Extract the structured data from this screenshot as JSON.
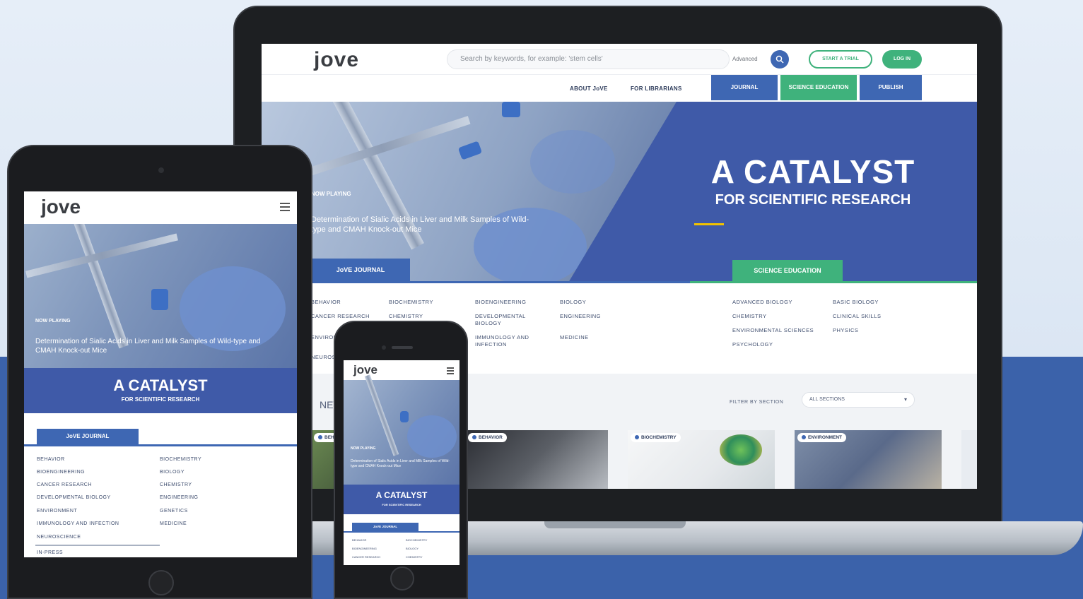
{
  "colors": {
    "brand_blue": "#3e67b3",
    "hero_blue": "#3f5aa8",
    "brand_green": "#3fb27c",
    "accent_yellow": "#f2c300",
    "background_blue": "#3b62aa"
  },
  "laptop": {
    "logo": "jove",
    "search_placeholder": "Search by keywords, for example: 'stem cells'",
    "advanced": "Advanced",
    "search_icon": "search-icon",
    "start_trial": "START A TRIAL",
    "login": "LOG IN",
    "nav": {
      "about": "ABOUT JoVE",
      "librarians": "FOR LIBRARIANS",
      "journal": "JOURNAL",
      "science_education": "SCIENCE EDUCATION",
      "publish": "PUBLISH"
    },
    "hero": {
      "title": "A CATALYST",
      "subtitle": "FOR SCIENTIFIC RESEARCH",
      "now_playing": "NOW PLAYING",
      "video_title": "Determination of Sialic Acids in Liver and Milk Samples of Wild-type and CMAH Knock-out Mice",
      "tab_journal": "JoVE JOURNAL",
      "tab_science": "SCIENCE EDUCATION"
    },
    "journal_categories": [
      "BEHAVIOR",
      "BIOCHEMISTRY",
      "BIOENGINEERING",
      "BIOLOGY",
      "CANCER RESEARCH",
      "CHEMISTRY",
      "DEVELOPMENTAL BIOLOGY",
      "ENGINEERING",
      "ENVIRONMENT",
      "IMMUNOLOGY AND INFECTION",
      "MEDICINE",
      "NEUROSCIENCE"
    ],
    "science_categories": [
      "ADVANCED BIOLOGY",
      "BASIC BIOLOGY",
      "CHEMISTRY",
      "CLINICAL SKILLS",
      "ENVIRONMENTAL SCIENCES",
      "PHYSICS",
      "PSYCHOLOGY"
    ],
    "new_heading": "NEW",
    "filter_label": "FILTER BY SECTION",
    "filter_value": "ALL SECTIONS",
    "cards": [
      {
        "tag": "BEHAVIOR"
      },
      {
        "tag": "BEHAVIOR"
      },
      {
        "tag": "BIOCHEMISTRY"
      },
      {
        "tag": "ENVIRONMENT"
      }
    ]
  },
  "tablet": {
    "logo": "jove",
    "now_playing": "NOW PLAYING",
    "video_title": "Determination of Sialic Acids in Liver and Milk Samples of Wild-type and CMAH Knock-out Mice",
    "title": "A CATALYST",
    "subtitle": "FOR SCIENTIFIC RESEARCH",
    "tab_journal": "JoVE JOURNAL",
    "categories_left": [
      "BEHAVIOR",
      "BIOENGINEERING",
      "CANCER RESEARCH",
      "DEVELOPMENTAL BIOLOGY",
      "ENVIRONMENT",
      "IMMUNOLOGY AND INFECTION",
      "NEUROSCIENCE"
    ],
    "categories_right": [
      "BIOCHEMISTRY",
      "BIOLOGY",
      "CHEMISTRY",
      "ENGINEERING",
      "GENETICS",
      "MEDICINE"
    ],
    "in_press": "IN-PRESS"
  },
  "phone": {
    "logo": "jove",
    "now_playing": "NOW PLAYING",
    "video_title": "Determination of Sialic Acids in Liver and Milk Samples of Wild-type and CMAH Knock-out Mice",
    "title": "A CATALYST",
    "subtitle": "FOR SCIENTIFIC RESEARCH",
    "tab_journal": "JoVE JOURNAL",
    "categories": [
      "BEHAVIOR",
      "BIOCHEMISTRY",
      "BIOENGINEERING",
      "BIOLOGY",
      "CANCER RESEARCH",
      "CHEMISTRY"
    ]
  }
}
